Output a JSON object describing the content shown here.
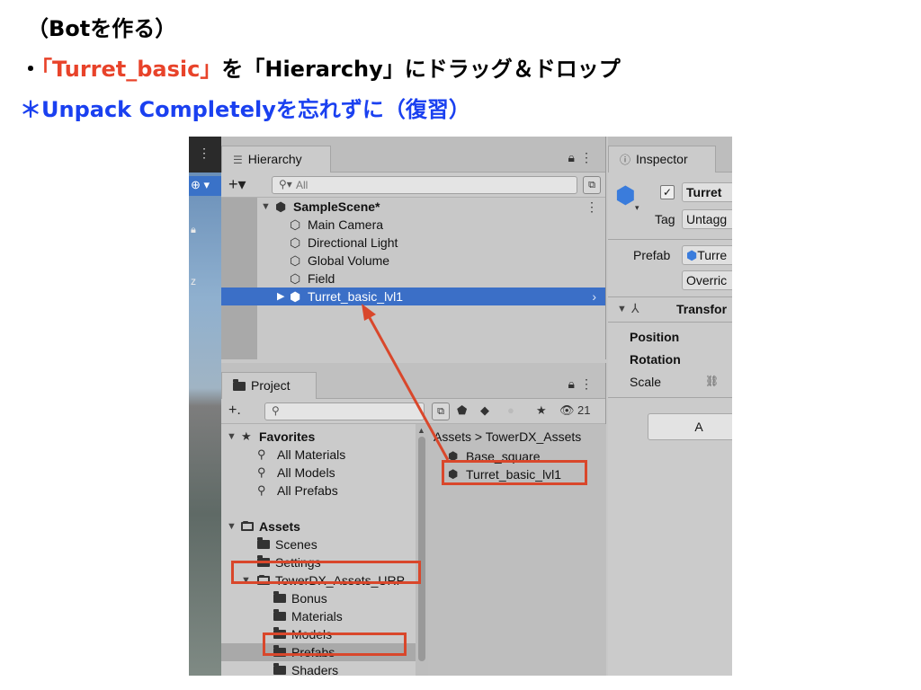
{
  "slide": {
    "line1": "（Botを作る）",
    "line2_bullet": "・",
    "line2_highlight": "「Turret_basic」",
    "line2_rest": "を「Hierarchy」にドラッグ＆ドロップ",
    "line3": "＊Unpack Completelyを忘れずに（復習）"
  },
  "colors": {
    "highlight_red": "#e8432a",
    "note_blue": "#1a40f0",
    "selection_blue": "#3b6fc7",
    "box_red": "#d9472b"
  },
  "hierarchy": {
    "tab_label": "Hierarchy",
    "search_placeholder": "All",
    "scene_name": "SampleScene*",
    "items": [
      {
        "label": "Main Camera",
        "icon": "gameobject-cube-icon"
      },
      {
        "label": "Directional Light",
        "icon": "gameobject-cube-icon"
      },
      {
        "label": "Global Volume",
        "icon": "gameobject-cube-icon"
      },
      {
        "label": "Field",
        "icon": "gameobject-cube-icon"
      },
      {
        "label": "Turret_basic_lvl1",
        "icon": "prefab-cube-icon",
        "selected": true
      }
    ]
  },
  "project": {
    "tab_label": "Project",
    "hidden_count": "21",
    "favorites": {
      "label": "Favorites",
      "items": [
        "All Materials",
        "All Models",
        "All Prefabs"
      ]
    },
    "assets": {
      "label": "Assets",
      "children": [
        "Scenes",
        "Settings"
      ],
      "package": "TowerDX_Assets_URP",
      "package_children": [
        "Bonus",
        "Materials",
        "Models",
        "Prefabs",
        "Shaders"
      ]
    },
    "breadcrumb": [
      "Assets",
      "TowerDX_Assets"
    ],
    "files": [
      "Base_square",
      "Turret_basic_lvl1"
    ]
  },
  "inspector": {
    "tab_label": "Inspector",
    "object_name": "Turret",
    "tag_label": "Tag",
    "tag_value": "Untagg",
    "prefab_label": "Prefab",
    "prefab_value": "Turre",
    "overrides_label": "Overric",
    "transform_label": "Transfor",
    "position_label": "Position",
    "rotation_label": "Rotation",
    "scale_label": "Scale",
    "add_button_label": "A"
  }
}
